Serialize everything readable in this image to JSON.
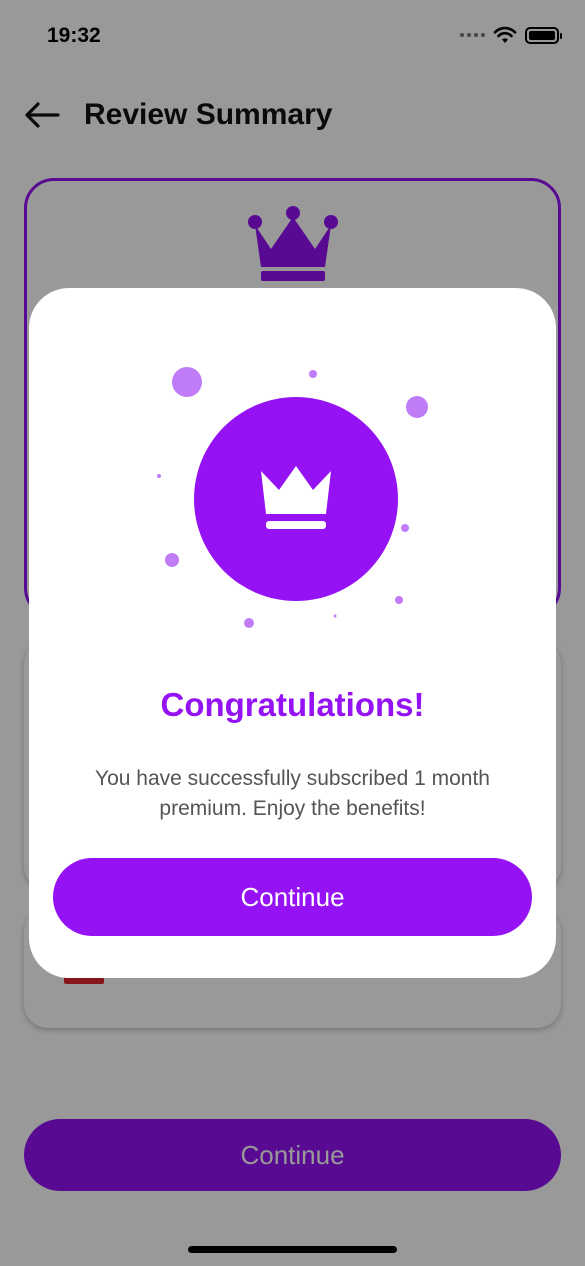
{
  "status_bar": {
    "time": "19:32"
  },
  "header": {
    "title": "Review Summary"
  },
  "background": {
    "continue_label": "Continue"
  },
  "dialog": {
    "title": "Congratulations!",
    "message": "You have successfully subscribed 1 month premium. Enjoy the benefits!",
    "continue_label": "Continue"
  },
  "colors": {
    "accent": "#9512F5",
    "accent_light": "#C07CF7",
    "overlay": "rgba(0,0,0,0.40)"
  },
  "icons": [
    "back-arrow-icon",
    "crown-icon",
    "wifi-icon",
    "battery-icon",
    "signal-icon"
  ]
}
